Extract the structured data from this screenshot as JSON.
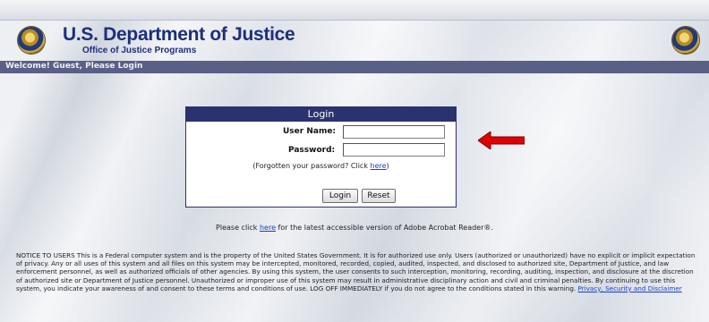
{
  "header": {
    "agency_title": "U.S. Department of Justice",
    "agency_subtitle": "Office of Justice Programs",
    "seal_icon": "doj-seal-icon"
  },
  "welcome_bar": {
    "text": "Welcome! Guest, Please Login"
  },
  "login": {
    "title": "Login",
    "username_label": "User Name:",
    "username_value": "",
    "password_label": "Password:",
    "password_value": "",
    "forgot_prefix": "(Forgotten your password? Click ",
    "forgot_link": "here",
    "forgot_suffix": ")",
    "login_button": "Login",
    "reset_button": "Reset"
  },
  "acrobat": {
    "prefix": "Please click ",
    "link": "here",
    "suffix": " for the latest accessible version of Adobe Acrobat Reader®."
  },
  "notice": {
    "text": "NOTICE TO USERS This is a Federal computer system and is the property of the United States Government. It is for authorized use only. Users (authorized or unauthorized) have no explicit or implicit expectation of privacy. Any or all uses of this system and all files on this system may be intercepted, monitored, recorded, copied, audited, inspected, and disclosed to authorized site, Department of Justice, and law enforcement personnel, as well as authorized officials of other agencies. By using this system, the user consents to such interception, monitoring, recording, auditing, inspection, and disclosure at the discretion of authorized site or Department of Justice personnel. Unauthorized or improper use of this system may result in administrative disciplinary action and civil and criminal penalties. By continuing to use this system, you indicate your awareness of and consent to these terms and conditions of use. LOG OFF IMMEDIATELY if you do not agree to the conditions stated in this warning. ",
    "link": "Privacy, Security and Disclaimer"
  },
  "colors": {
    "header_text": "#1c2f7a",
    "welcome_bar": "#5a5f86",
    "login_header": "#2b3270",
    "link": "#1a3ec9",
    "arrow": "#e00000"
  },
  "annotation": {
    "arrow_icon": "red-arrow-icon"
  }
}
